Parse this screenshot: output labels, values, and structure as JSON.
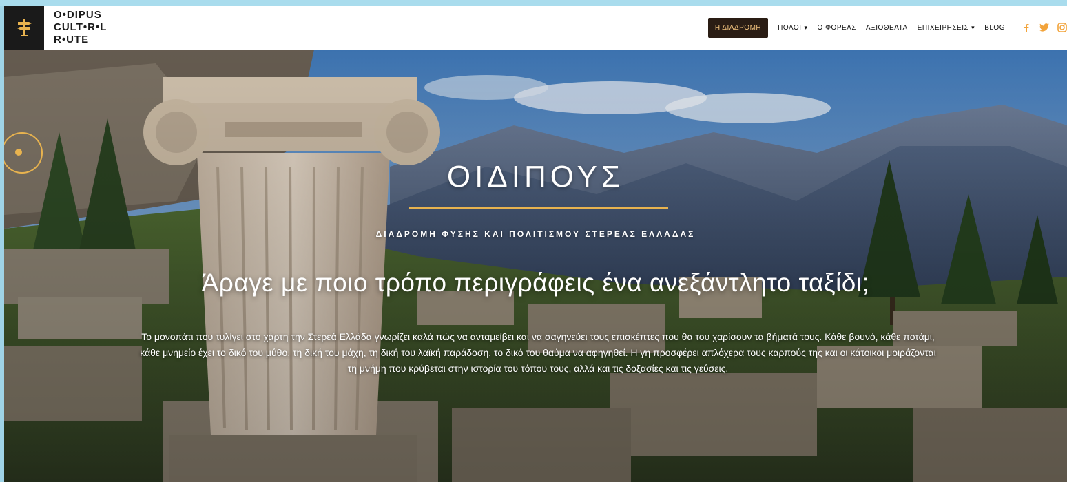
{
  "brand": {
    "line1": "O•DIPUS",
    "line2": "CULT•R•L",
    "line3": "R•UTE",
    "accent": "#e8b34f",
    "dark": "#1a1a1a"
  },
  "nav": {
    "items": [
      {
        "label": "Η ΔΙΑΔΡΟΜΗ",
        "active": true
      },
      {
        "label": "ΠΟΛΟΙ",
        "dropdown": true
      },
      {
        "label": "Ο ΦΟΡΕΑΣ"
      },
      {
        "label": "ΑΞΙΟΘΕΑΤΑ"
      },
      {
        "label": "ΕΠΙΧΕΙΡΗΣΕΙΣ",
        "dropdown": true
      },
      {
        "label": "BLOG"
      }
    ],
    "social_icons": [
      "facebook-icon",
      "twitter-icon",
      "instagram-icon"
    ]
  },
  "hero": {
    "title": "ΟΙΔΙΠΟΥΣ",
    "subtitle": "ΔΙΑΔΡΟΜΗ ΦΥΣΗΣ ΚΑΙ ΠΟΛΙΤΙΣΜΟΥ ΣΤΕΡΕΑΣ ΕΛΛΑΔΑΣ",
    "headline": "Άραγε με ποιο τρόπο περιγράφεις ένα ανεξάντλητο ταξίδι;",
    "paragraph": "Το μονοπάτι που τυλίγει στο χάρτη την Στερεά Ελλάδα γνωρίζει καλά πώς να ανταμείβει και να σαγηνεύει τους επισκέπτες που θα του χαρίσουν τα βήματά τους. Κάθε βουνό, κάθε ποτάμι, κάθε μνημείο έχει το δικό του μύθο, τη δική του μάχη, τη δική του λαϊκή παράδοση, το δικό του θαύμα να αφηγηθεί. Η γη προσφέρει απλόχερα τους καρπούς της και οι κάτοικοι μοιράζονται τη μνήμη που κρύβεται στην ιστορία του τόπου τους, αλλά και τις δοξασίες και τις γεύσεις."
  }
}
